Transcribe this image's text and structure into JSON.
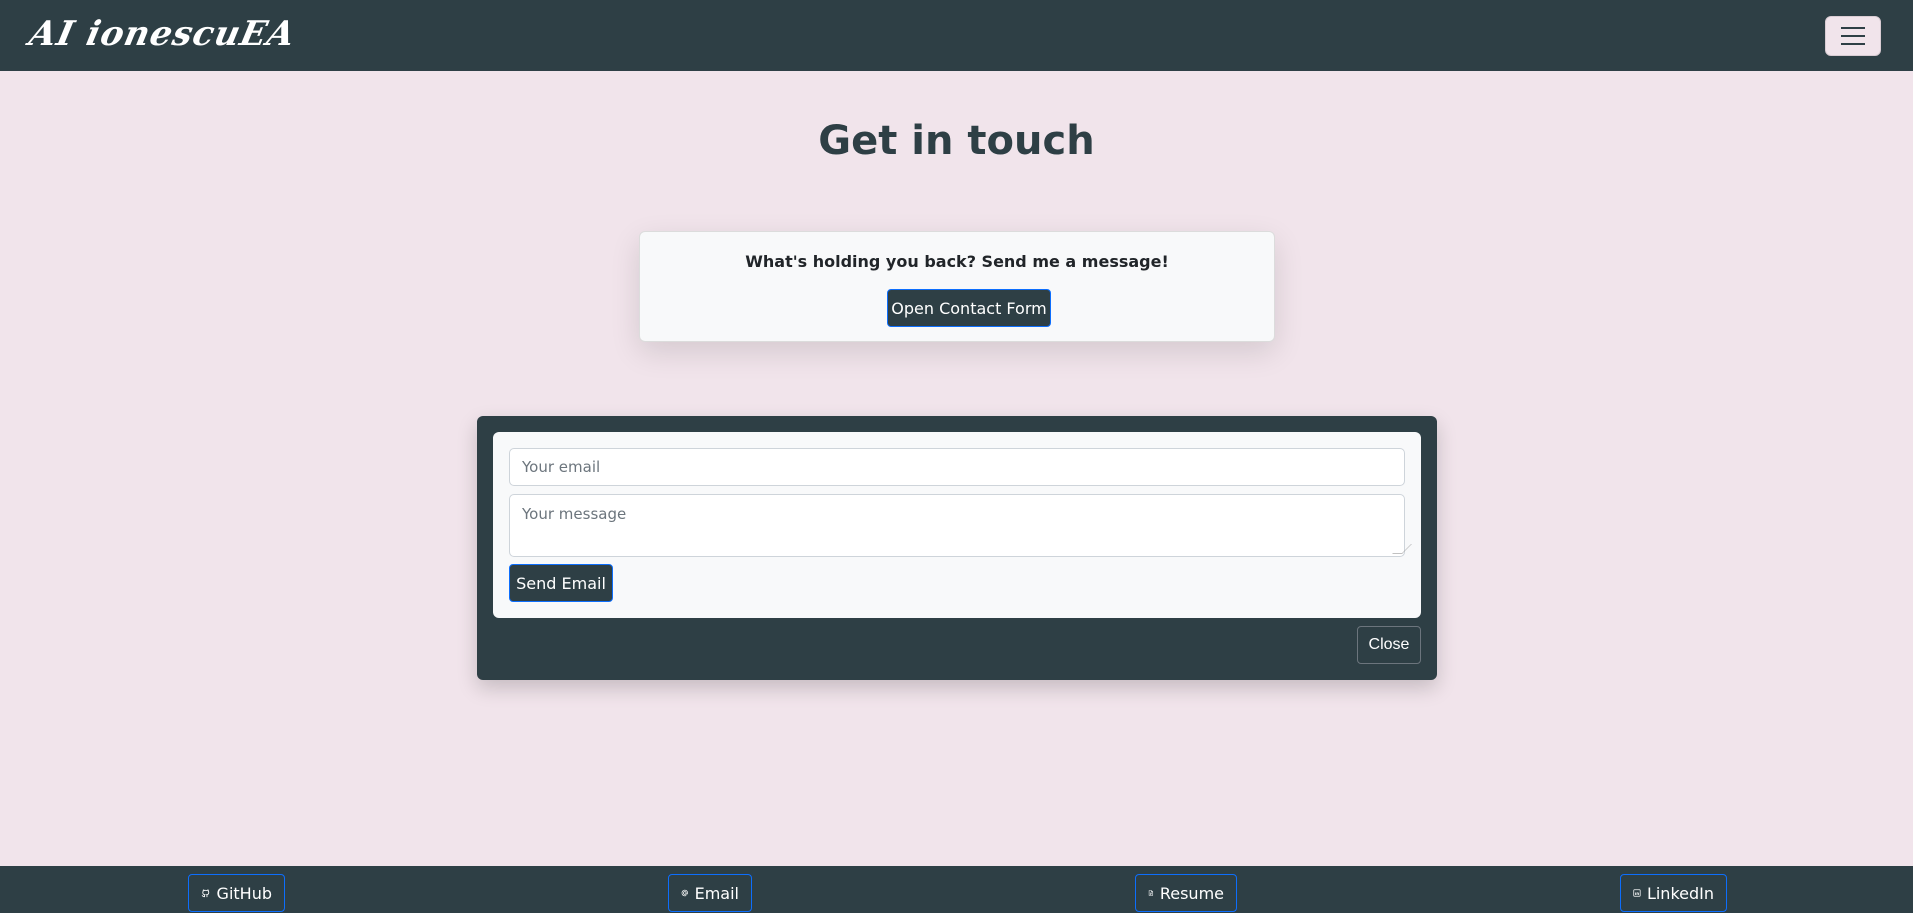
{
  "navbar": {
    "brand": "AI ionescuEA",
    "menu_icon": "hamburger-icon"
  },
  "page": {
    "title": "Get in touch"
  },
  "cta": {
    "text": "What's holding you back? Send me a message!",
    "button_label": "Open Contact Form"
  },
  "contact_form": {
    "email_placeholder": "Your email",
    "email_value": "",
    "message_placeholder": "Your message",
    "message_value": "",
    "send_label": "Send Email",
    "close_label": "Close"
  },
  "footer": {
    "links": [
      {
        "label": "GitHub",
        "icon": "github-icon"
      },
      {
        "label": "Email",
        "icon": "at-icon"
      },
      {
        "label": "Resume",
        "icon": "document-icon"
      },
      {
        "label": "LinkedIn",
        "icon": "linkedin-icon"
      }
    ]
  },
  "colors": {
    "dark": "#2e3f45",
    "background": "#f1e4eb",
    "accent_border": "#0d6efd"
  }
}
